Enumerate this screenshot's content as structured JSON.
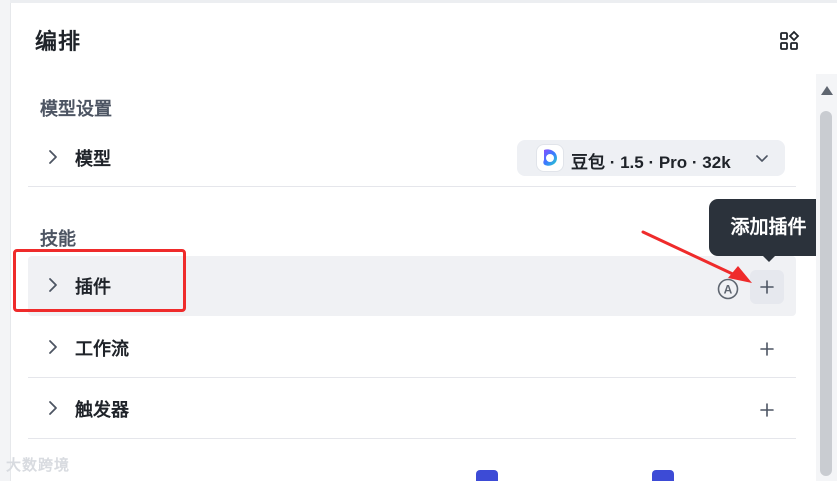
{
  "header": {
    "title": "编排"
  },
  "sections": {
    "model_settings": "模型设置",
    "skills": "技能"
  },
  "rows": {
    "model": "模型",
    "plugins": "插件",
    "workflow": "工作流",
    "trigger": "触发器"
  },
  "model_select": {
    "value": "豆包 · 1.5 · Pro · 32k"
  },
  "tooltip": {
    "text": "添加插件"
  },
  "auto_icon": {
    "letter": "A"
  },
  "watermark": {
    "text": "大数跨境"
  },
  "icons": [
    "layout-grid-icon",
    "chevron-right-icon",
    "plus-icon",
    "auto-icon",
    "chevron-down-icon"
  ],
  "colors": {
    "highlight_border": "#ef2b2b",
    "tooltip_bg": "#2b323b",
    "accent": "#3d4bd6"
  }
}
